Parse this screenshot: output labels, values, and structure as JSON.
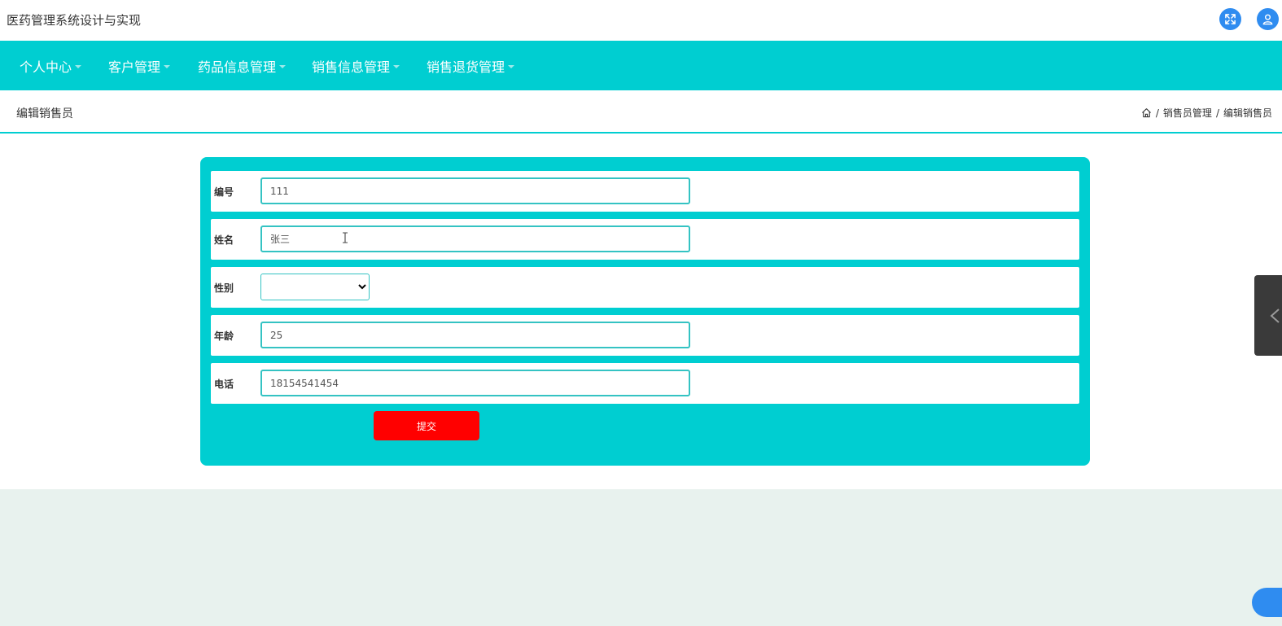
{
  "app": {
    "title": "医药管理系统设计与实现"
  },
  "nav": {
    "items": [
      {
        "label": "个人中心"
      },
      {
        "label": "客户管理"
      },
      {
        "label": "药品信息管理"
      },
      {
        "label": "销售信息管理"
      },
      {
        "label": "销售退货管理"
      }
    ]
  },
  "page": {
    "title": "编辑销售员",
    "breadcrumb": [
      "销售员管理",
      "编辑销售员"
    ],
    "breadcrumb_sep": "/"
  },
  "form": {
    "fields": [
      {
        "label": "编号",
        "value": "111"
      },
      {
        "label": "姓名",
        "value": "张三"
      },
      {
        "label": "性别",
        "value": ""
      },
      {
        "label": "年龄",
        "value": "25"
      },
      {
        "label": "电话",
        "value": "18154541454"
      }
    ],
    "submit_label": "提交"
  },
  "icons": {
    "fullscreen": "expand-arrows-icon",
    "user": "user-icon",
    "home": "home-icon",
    "side_tab": "chevron-left-icon"
  },
  "colors": {
    "primary": "#00ced1",
    "submit": "#ff0000",
    "icon_blue": "#2f8cf0"
  }
}
